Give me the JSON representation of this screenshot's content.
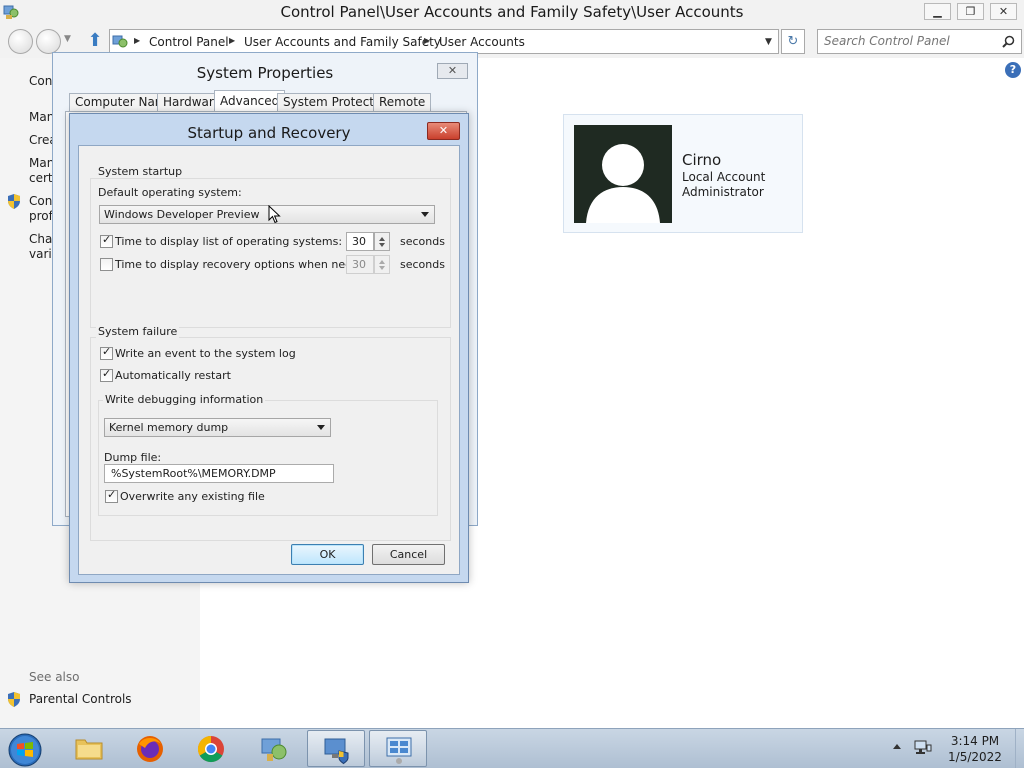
{
  "control_panel": {
    "title": "Control Panel\\User Accounts and Family Safety\\User Accounts",
    "breadcrumbs": [
      "Control Panel",
      "User Accounts and Family Safety",
      "User Accounts"
    ],
    "search_placeholder": "Search Control Panel",
    "sidebar": {
      "items": [
        "Cont",
        "Man",
        "Crea",
        "Man",
        "certi",
        "Cont",
        "profi",
        "Char",
        "varia"
      ],
      "see_also": "See also",
      "parental_controls": "Parental Controls"
    },
    "user": {
      "name": "Cirno",
      "type": "Local Account",
      "role": "Administrator"
    }
  },
  "system_properties": {
    "title": "System Properties",
    "tabs": [
      "Computer Name",
      "Hardware",
      "Advanced",
      "System Protection",
      "Remote"
    ],
    "active_tab": "Advanced"
  },
  "startup_recovery": {
    "title": "Startup and Recovery",
    "system_startup": {
      "group_label": "System startup",
      "default_os_label": "Default operating system:",
      "default_os_value": "Windows Developer Preview",
      "display_list_label": "Time to display list of operating systems:",
      "display_list_checked": true,
      "display_list_value": "30",
      "display_recovery_label": "Time to display recovery options when needed:",
      "display_recovery_checked": false,
      "display_recovery_value": "30",
      "seconds_label": "seconds"
    },
    "system_failure": {
      "group_label": "System failure",
      "write_event_label": "Write an event to the system log",
      "write_event_checked": true,
      "auto_restart_label": "Automatically restart",
      "auto_restart_checked": true,
      "debug_group_label": "Write debugging information",
      "debug_type_value": "Kernel memory dump",
      "dump_file_label": "Dump file:",
      "dump_file_value": "%SystemRoot%\\MEMORY.DMP",
      "overwrite_label": "Overwrite any existing file",
      "overwrite_checked": true
    },
    "buttons": {
      "ok": "OK",
      "cancel": "Cancel"
    }
  },
  "taskbar": {
    "items": [
      "file-explorer",
      "firefox",
      "chrome",
      "control-panel",
      "system-properties",
      "remote-desktop"
    ],
    "clock_time": "3:14 PM",
    "clock_date": "1/5/2022"
  },
  "colors": {
    "accent": "#3b6fb8",
    "close_red": "#c9402d",
    "taskbar": "#bccbdc"
  }
}
